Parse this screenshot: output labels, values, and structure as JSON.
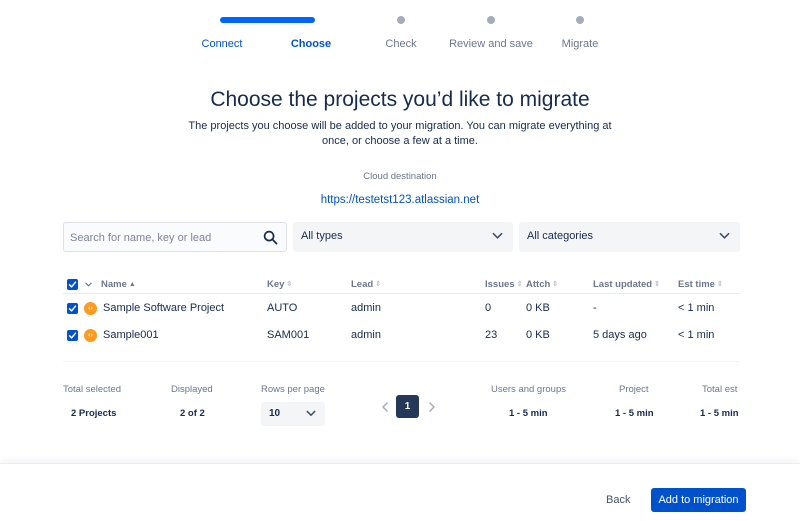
{
  "stepper": {
    "steps": [
      {
        "label": "Connect",
        "state": "done"
      },
      {
        "label": "Choose",
        "state": "active"
      },
      {
        "label": "Check",
        "state": "todo"
      },
      {
        "label": "Review and save",
        "state": "todo"
      },
      {
        "label": "Migrate",
        "state": "todo"
      }
    ]
  },
  "header": {
    "title": "Choose the projects you’d like to migrate",
    "subtitle": "The projects you choose will be added to your migration. You can migrate everything at once, or choose a few at a time.",
    "destination_label": "Cloud destination",
    "destination_url": "https://testetst123.atlassian.net"
  },
  "filters": {
    "search_placeholder": "Search for name, key or lead",
    "search_value": "",
    "type_select": "All types",
    "category_select": "All categories"
  },
  "table": {
    "select_all_checked": true,
    "columns": [
      {
        "label": "Name",
        "sort": "asc"
      },
      {
        "label": "Key",
        "sort": "none"
      },
      {
        "label": "Lead",
        "sort": "none"
      },
      {
        "label": "Issues",
        "sort": "none"
      },
      {
        "label": "Attch",
        "sort": "none"
      },
      {
        "label": "Last updated",
        "sort": "none"
      },
      {
        "label": "Est time",
        "sort": "none"
      }
    ],
    "rows": [
      {
        "checked": true,
        "icon": "software-project-icon",
        "name": "Sample Software Project",
        "key": "AUTO",
        "lead": "admin",
        "issues": "0",
        "attachments": "0 KB",
        "last_updated": "-",
        "est_time": "< 1 min"
      },
      {
        "checked": true,
        "icon": "software-project-icon",
        "name": "Sample001",
        "key": "SAM001",
        "lead": "admin",
        "issues": "23",
        "attachments": "0 KB",
        "last_updated": "5 days ago",
        "est_time": "< 1 min"
      }
    ]
  },
  "summary": {
    "total_selected_label": "Total selected",
    "total_selected_value": "2 Projects",
    "displayed_label": "Displayed",
    "displayed_value": "2 of 2",
    "rows_per_page_label": "Rows per page",
    "rows_per_page_value": "10",
    "current_page": "1",
    "users_groups_label": "Users and groups",
    "users_groups_value": "1 - 5 min",
    "project_label": "Project",
    "project_value": "1 - 5 min",
    "total_est_label": "Total est",
    "total_est_value": "1 - 5 min"
  },
  "footer": {
    "back_label": "Back",
    "add_label": "Add to migration"
  },
  "colors": {
    "primary": "#0052cc",
    "progress": "#0065ff",
    "text": "#172b4d",
    "muted": "#6b778c",
    "project_icon": "#ff991f",
    "page_active": "#253858"
  }
}
